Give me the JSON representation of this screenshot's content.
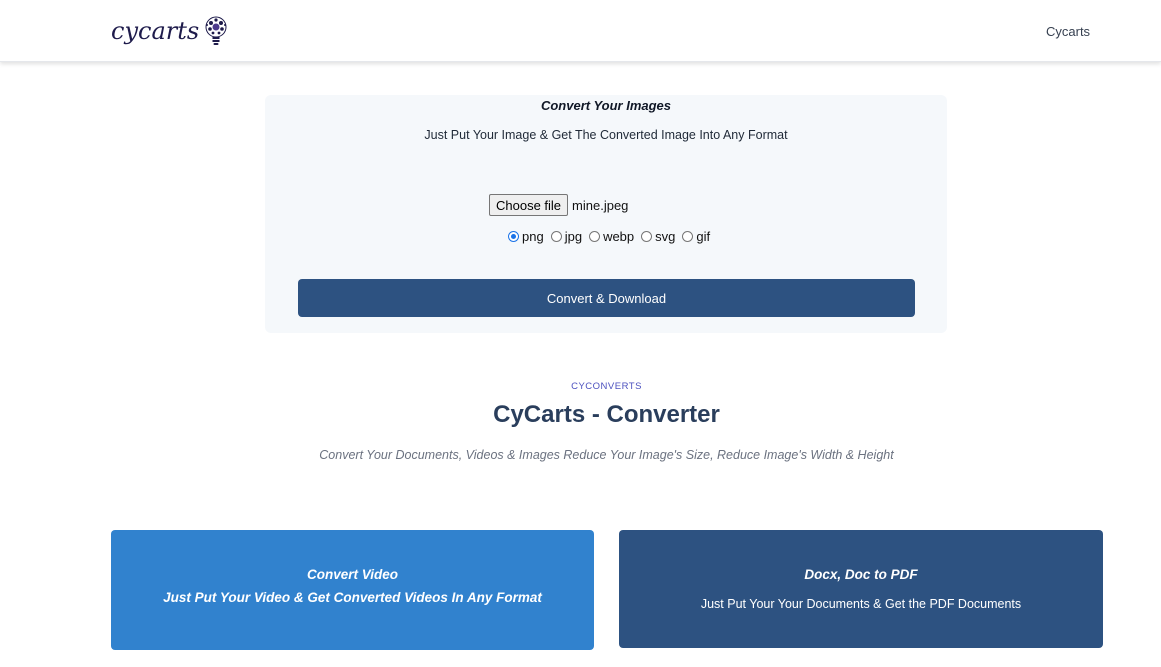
{
  "header": {
    "logo_text": "cycarts",
    "nav_link": "Cycarts"
  },
  "converter": {
    "title": "Convert Your Images",
    "subtitle": "Just Put Your Image & Get The Converted Image Into Any Format",
    "choose_file_label": "Choose file",
    "file_name": "mine.jpeg",
    "formats": [
      {
        "label": "png",
        "checked": true
      },
      {
        "label": "jpg",
        "checked": false
      },
      {
        "label": "webp",
        "checked": false
      },
      {
        "label": "svg",
        "checked": false
      },
      {
        "label": "gif",
        "checked": false
      }
    ],
    "convert_button": "Convert & Download"
  },
  "hero": {
    "eyebrow": "CYCONVERTS",
    "title": "CyCarts - Converter",
    "subtitle": "Convert Your Documents, Videos & Images Reduce Your Image's Size, Reduce Image's Width & Height"
  },
  "tiles": [
    {
      "title": "Convert Video",
      "description": "Just Put Your Video & Get Converted Videos In Any Format"
    },
    {
      "title": "Docx, Doc to PDF",
      "description": "Just Put Your Your Documents & Get the PDF Documents"
    }
  ],
  "colors": {
    "primary_dark": "#2d5281",
    "primary_light": "#3182ce",
    "accent": "#4c51bf"
  }
}
